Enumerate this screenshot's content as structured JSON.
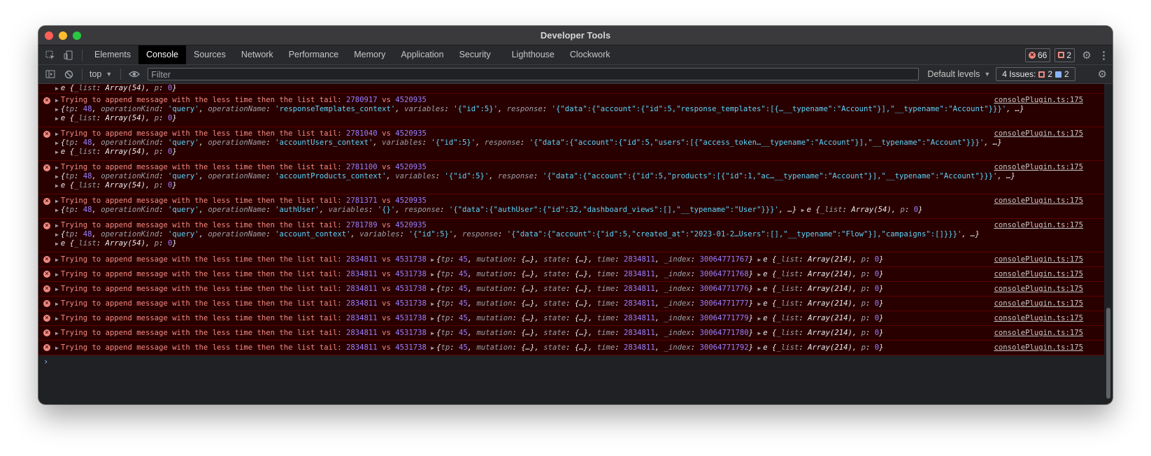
{
  "window": {
    "title": "Developer Tools"
  },
  "tabs": [
    {
      "label": "Elements",
      "active": false
    },
    {
      "label": "Console",
      "active": true
    },
    {
      "label": "Sources",
      "active": false
    },
    {
      "label": "Network",
      "active": false
    },
    {
      "label": "Performance",
      "active": false
    },
    {
      "label": "Memory",
      "active": false
    },
    {
      "label": "Application",
      "active": false
    },
    {
      "label": "Security",
      "active": false
    },
    {
      "label": "Lighthouse",
      "active": false
    },
    {
      "label": "Clockwork",
      "active": false
    }
  ],
  "counts": {
    "errors": "66",
    "warnings": "2"
  },
  "toolbar": {
    "context": "top",
    "filter_placeholder": "Filter",
    "levels": "Default levels",
    "issues_label": "4 Issues:",
    "issues_errors": "2",
    "issues_info": "2"
  },
  "messages": {
    "source": "consolePlugin.ts:175",
    "prefix": "Trying to append message with the less time then the list tail: ",
    "list_54": "e {_list: Array(54), p: 0}",
    "grouped": [
      {
        "t1": "2780917",
        "t2": "4520935",
        "op": "'responseTemplates_context'",
        "vars": "'{\"id\":5}'",
        "resp": "'{\"data\":{\"account\":{\"id\":5,\"response_templates\":[{…__typename\":\"Account\"}],\"__typename\":\"Account\"}}}'"
      },
      {
        "t1": "2781040",
        "t2": "4520935",
        "op": "'accountUsers_context'",
        "vars": "'{\"id\":5}'",
        "resp": "'{\"data\":{\"account\":{\"id\":5,\"users\":[{\"access_token…__typename\":\"Account\"}],\"__typename\":\"Account\"}}}'"
      },
      {
        "t1": "2781100",
        "t2": "4520935",
        "op": "'accountProducts_context'",
        "vars": "'{\"id\":5}'",
        "resp": "'{\"data\":{\"account\":{\"id\":5,\"products\":[{\"id\":1,\"ac…__typename\":\"Account\"}],\"__typename\":\"Account\"}}}'"
      },
      {
        "t1": "2781371",
        "t2": "4520935",
        "op": "'authUser'",
        "vars": "'{}'",
        "resp": "'{\"data\":{\"authUser\":{\"id\":32,\"dashboard_views\":[],\"__typename\":\"User\"}}}'"
      },
      {
        "t1": "2781789",
        "t2": "4520935",
        "op": "'account_context'",
        "vars": "'{\"id\":5}'",
        "resp": "'{\"data\":{\"account\":{\"id\":5,\"created_at\":\"2023-01-2…Users\":[],\"__typename\":\"Flow\"}],\"campaigns\":[]}}}'"
      }
    ],
    "tp_grouped": "48",
    "kind": "'query'",
    "single": {
      "t1": "2834811",
      "t2": "4531738",
      "tp": "45",
      "time": "2834811",
      "list": "Array(214)",
      "p": "0",
      "indices": [
        "30064771767",
        "30064771768",
        "30064771776",
        "30064771777",
        "30064771779",
        "30064771780",
        "30064771792"
      ]
    }
  },
  "colors": {
    "error_bg": "#290000",
    "error_text": "#f28b82",
    "number": "#9980ff",
    "string": "#5cd5fb"
  }
}
